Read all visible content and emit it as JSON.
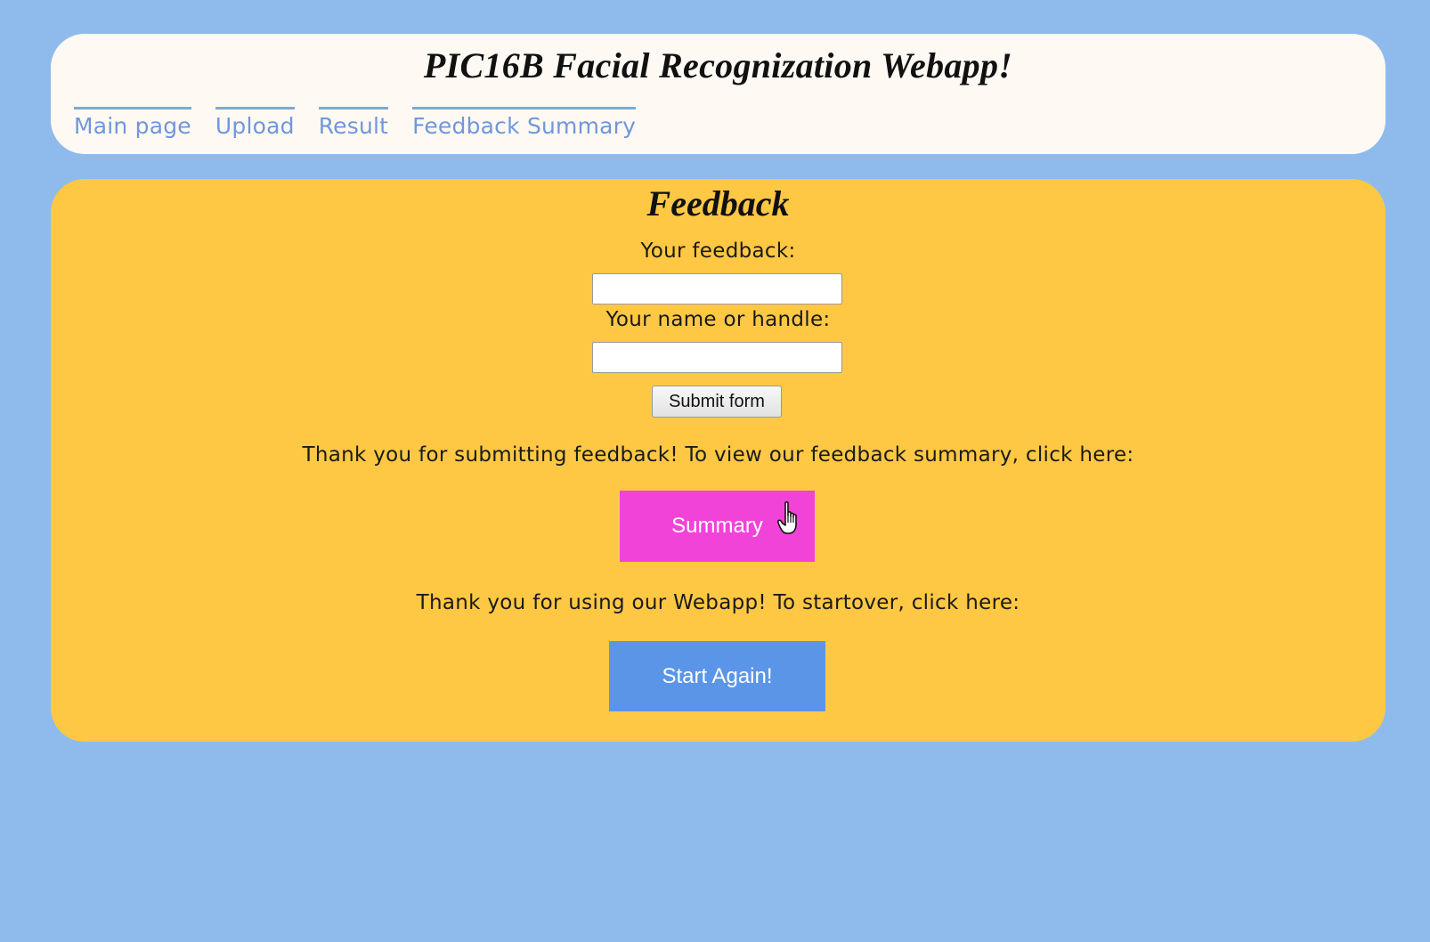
{
  "header": {
    "title": "PIC16B Facial Recognization Webapp!",
    "nav": [
      {
        "label": "Main page"
      },
      {
        "label": "Upload"
      },
      {
        "label": "Result"
      },
      {
        "label": "Feedback Summary"
      }
    ]
  },
  "feedback": {
    "heading": "Feedback",
    "feedback_label": "Your feedback:",
    "feedback_value": "",
    "name_label": "Your name or handle:",
    "name_value": "",
    "submit_label": "Submit form",
    "summary_message": "Thank you for submitting feedback! To view our feedback summary, click here:",
    "summary_button": "Summary",
    "restart_message": "Thank you for using our Webapp! To startover, click here:",
    "restart_button": "Start Again!"
  },
  "colors": {
    "page_background": "#8fbbec",
    "header_background": "#fff9f3",
    "panel_background": "#fec844",
    "nav_link": "#6f97dc",
    "summary_button": "#f243d9",
    "start_button": "#5b95e8"
  },
  "icons": {
    "cursor": "hand-pointer-cursor-icon"
  }
}
